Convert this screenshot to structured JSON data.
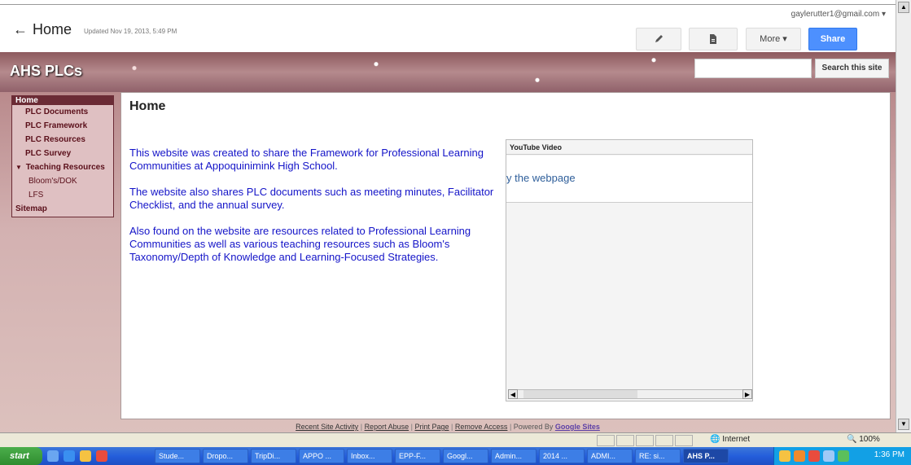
{
  "header": {
    "back_icon": "←",
    "page_title": "Home",
    "updated": "Updated Nov 19, 2013, 5:49 PM",
    "user": "gaylerutter1@gmail.com ▾",
    "more_label": "More ▾",
    "share_label": "Share"
  },
  "banner": {
    "site_title": "AHS PLCs",
    "search_button": "Search this site",
    "search_placeholder": ""
  },
  "nav": {
    "items": [
      {
        "label": "Home",
        "active": true
      },
      {
        "label": "PLC Documents"
      },
      {
        "label": "PLC Framework"
      },
      {
        "label": "PLC Resources"
      },
      {
        "label": "PLC Survey"
      },
      {
        "label": "Teaching Resources"
      },
      {
        "label": "Bloom's/DOK"
      },
      {
        "label": "LFS"
      },
      {
        "label": "Sitemap"
      }
    ]
  },
  "main": {
    "title": "Home",
    "paragraphs": [
      "This website was created to share the Framework for Professional Learning Communities at Appoquinimink High School.",
      "The website also shares PLC documents such as meeting minutes, Facilitator Checklist, and the annual survey.",
      "Also found on the website are resources related to Professional Learning Communities as well as various teaching resources such as Bloom's Taxonomy/Depth of Knowledge and Learning-Focused Strategies."
    ],
    "youtube": {
      "header": "YouTube Video",
      "message": "y the webpage"
    }
  },
  "footer": {
    "recent": "Recent Site Activity",
    "abuse": "Report Abuse",
    "print": "Print Page",
    "remove": "Remove Access",
    "powered": "Powered By",
    "google": "Google Sites"
  },
  "status": {
    "zone": "Internet",
    "zoom": "100%"
  },
  "taskbar": {
    "start": "start",
    "tasks": [
      "Stude...",
      "Dropo...",
      "TripDi...",
      "APPO ...",
      "Inbox...",
      "EPP-F...",
      "Googl...",
      "Admin...",
      "2014 ...",
      "ADMI...",
      "RE: si...",
      "AHS P..."
    ],
    "clock": "1:36 PM"
  }
}
